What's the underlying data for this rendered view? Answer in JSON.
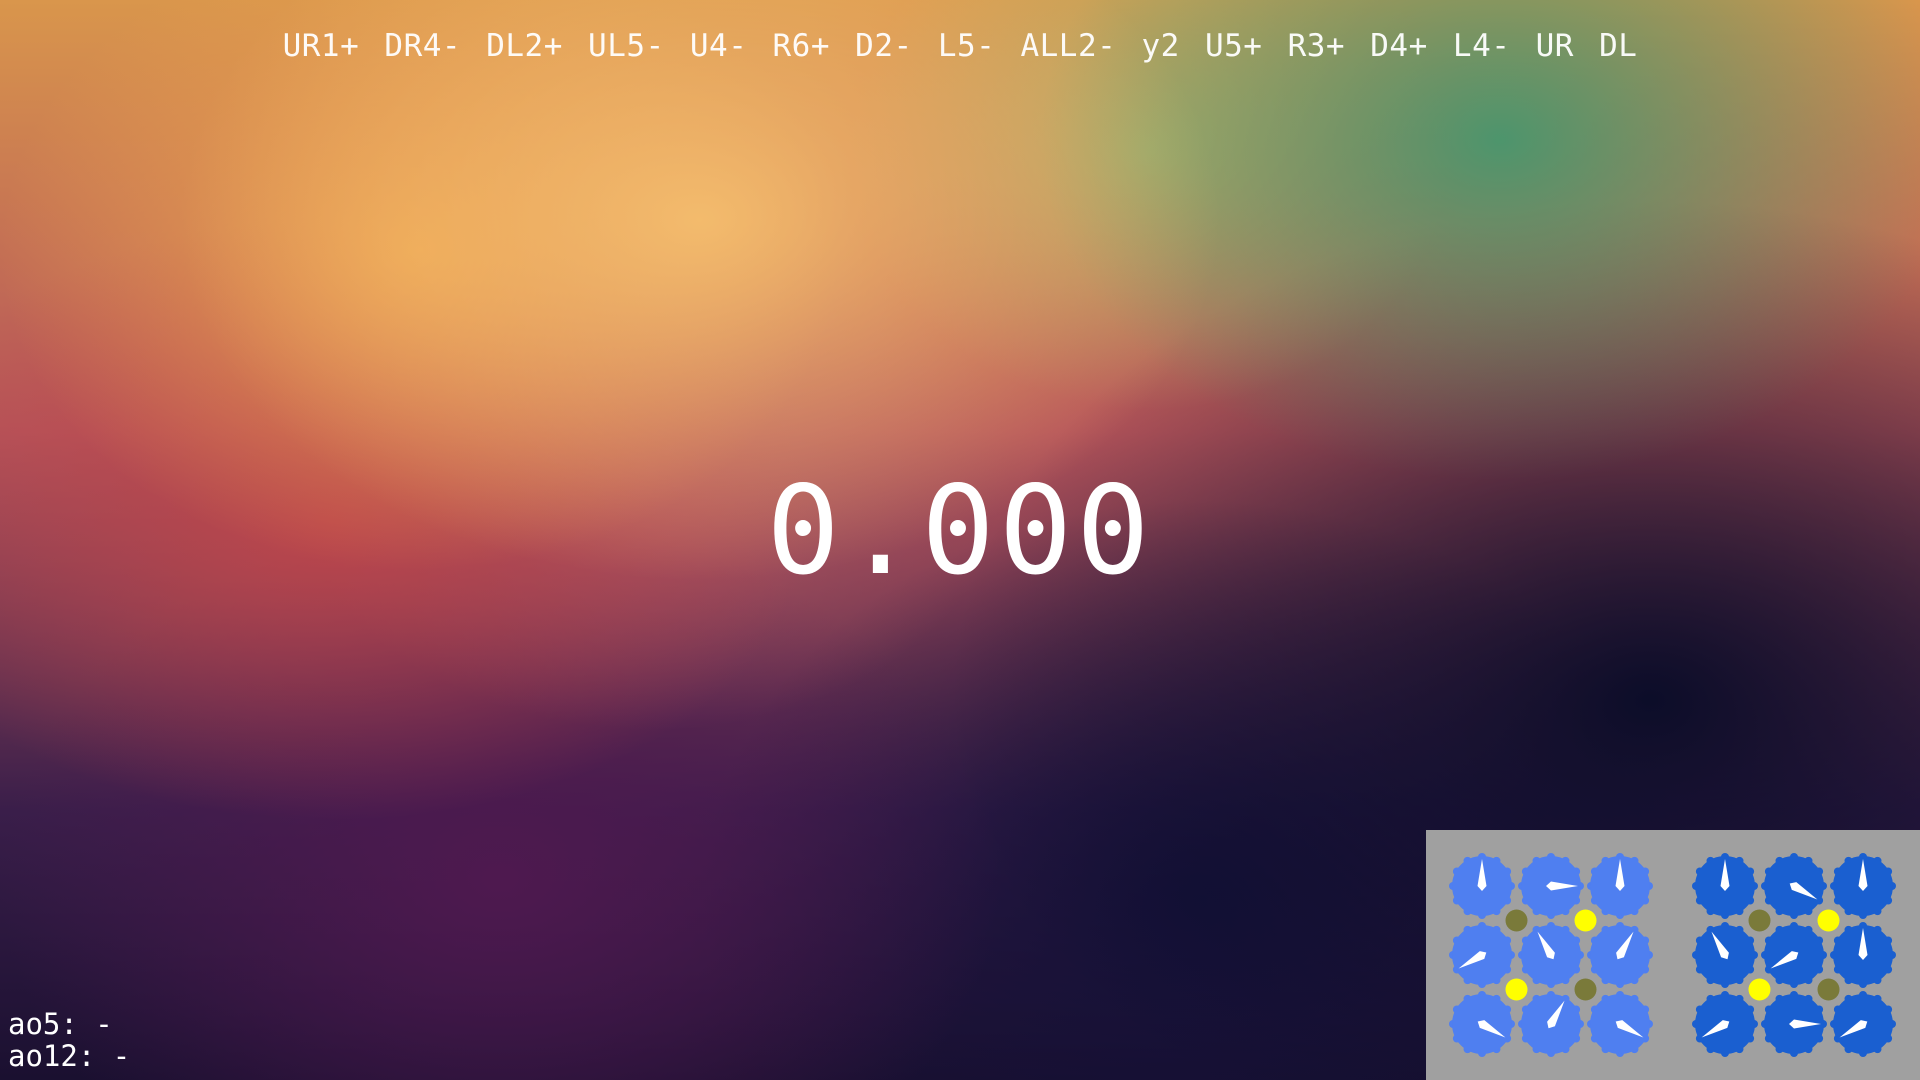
{
  "scramble": "UR1+ DR4- DL2+ UL5- U4- R6+ D2- L5- ALL2- y2 U5+ R3+ D4+ L4- UR DL",
  "timer": "0.000",
  "averages": {
    "ao5": "ao5: -",
    "ao12": "ao12: -"
  },
  "preview": {
    "colors": {
      "background": "#a0a0a0",
      "front_clock": "#4f7ff0",
      "back_clock": "#1a5fd0",
      "hand": "#ffffff",
      "pin_up": "#ffff00",
      "pin_down": "#7a7a3a"
    },
    "front": {
      "hours": [
        12,
        3,
        12,
        8,
        11,
        1,
        4,
        1,
        4
      ],
      "pins": [
        "down",
        "up",
        "up",
        "down"
      ]
    },
    "back": {
      "hours": [
        12,
        4,
        12,
        11,
        8,
        12,
        8,
        3,
        8
      ],
      "pins": [
        "down",
        "up",
        "up",
        "down"
      ]
    }
  }
}
